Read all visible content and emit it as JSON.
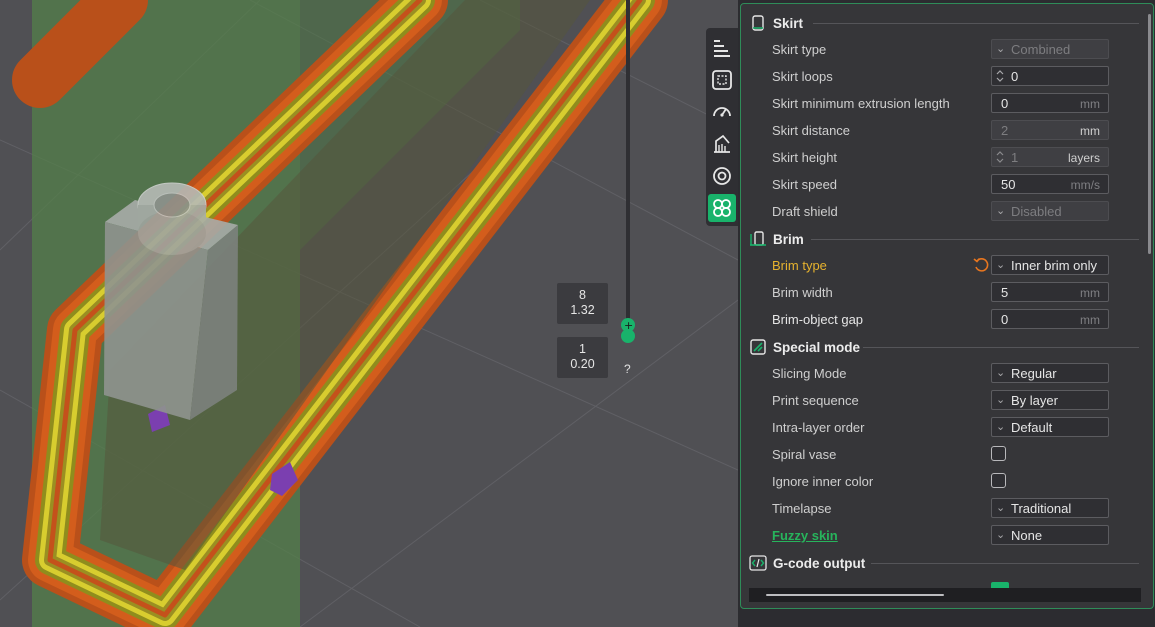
{
  "viewport": {
    "layer_top": {
      "number": "8",
      "height": "1.32"
    },
    "layer_bottom": {
      "number": "1",
      "height": "0.20"
    },
    "help_mark": "?"
  },
  "toolbar": {
    "tools": [
      {
        "icon": "arrange-icon",
        "active": false
      },
      {
        "icon": "slice-plate-icon",
        "active": false
      },
      {
        "icon": "speed-dial-icon",
        "active": false
      },
      {
        "icon": "support-paint-icon",
        "active": false
      },
      {
        "icon": "seam-target-icon",
        "active": false
      },
      {
        "icon": "others-clover-icon",
        "active": true
      }
    ]
  },
  "settings": {
    "skirt": {
      "title": "Skirt",
      "skirt_type": {
        "label": "Skirt type",
        "value": "Combined"
      },
      "skirt_loops": {
        "label": "Skirt loops",
        "value": "0"
      },
      "skirt_min_extrusion": {
        "label": "Skirt minimum extrusion length",
        "value": "0",
        "unit": "mm"
      },
      "skirt_distance": {
        "label": "Skirt distance",
        "value": "2",
        "unit": "mm"
      },
      "skirt_height": {
        "label": "Skirt height",
        "value": "1",
        "unit": "layers"
      },
      "skirt_speed": {
        "label": "Skirt speed",
        "value": "50",
        "unit": "mm/s"
      },
      "draft_shield": {
        "label": "Draft shield",
        "value": "Disabled"
      }
    },
    "brim": {
      "title": "Brim",
      "brim_type": {
        "label": "Brim type",
        "value": "Inner brim only"
      },
      "brim_width": {
        "label": "Brim width",
        "value": "5",
        "unit": "mm"
      },
      "brim_object_gap": {
        "label": "Brim-object gap",
        "value": "0",
        "unit": "mm"
      }
    },
    "special_mode": {
      "title": "Special mode",
      "slicing_mode": {
        "label": "Slicing Mode",
        "value": "Regular"
      },
      "print_sequence": {
        "label": "Print sequence",
        "value": "By layer"
      },
      "intra_layer_order": {
        "label": "Intra-layer order",
        "value": "Default"
      },
      "spiral_vase": {
        "label": "Spiral vase",
        "checked": false
      },
      "ignore_inner_color": {
        "label": "Ignore inner color",
        "checked": false
      },
      "timelapse": {
        "label": "Timelapse",
        "value": "Traditional"
      },
      "fuzzy_skin": {
        "label": "Fuzzy skin",
        "value": "None"
      }
    },
    "gcode_output": {
      "title": "G-code output"
    }
  },
  "colors": {
    "accent_green": "#19b36b",
    "modified_yellow": "#e6b22e",
    "link_green": "#27b45c",
    "extrusion_orange": "#d35d1c",
    "extrusion_yellow": "#c9c02a"
  }
}
